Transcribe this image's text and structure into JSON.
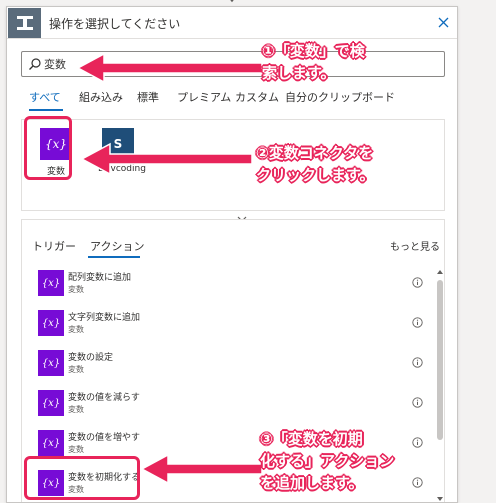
{
  "header": {
    "title": "操作を選択してください",
    "header_icon": "connector-step-icon",
    "close_icon": "close-icon"
  },
  "search": {
    "value": "変数",
    "placeholder": "",
    "icon": "search-icon"
  },
  "tabs": [
    {
      "label": "すべて",
      "active": true
    },
    {
      "label": "組み込み",
      "active": false
    },
    {
      "label": "標準",
      "active": false
    },
    {
      "label": "プレミアム",
      "active": false
    },
    {
      "label": "カスタム",
      "active": false
    },
    {
      "label": "自分のクリップボード",
      "active": false
    }
  ],
  "connectors": [
    {
      "label": "変数",
      "tile_glyph": "{x}",
      "color": "#770bd6"
    },
    {
      "label": "Devcoding",
      "tile_glyph": "S",
      "color": "#1f4e79"
    }
  ],
  "sub_tabs": [
    {
      "label": "トリガー",
      "active": false
    },
    {
      "label": "アクション",
      "active": true
    }
  ],
  "see_more": "もっと見る",
  "actions": [
    {
      "name": "配列変数に追加",
      "connector": "変数",
      "tile_glyph": "{x}"
    },
    {
      "name": "文字列変数に追加",
      "connector": "変数",
      "tile_glyph": "{x}"
    },
    {
      "name": "変数の設定",
      "connector": "変数",
      "tile_glyph": "{x}"
    },
    {
      "name": "変数の値を減らす",
      "connector": "変数",
      "tile_glyph": "{x}"
    },
    {
      "name": "変数の値を増やす",
      "connector": "変数",
      "tile_glyph": "{x}"
    },
    {
      "name": "変数を初期化する",
      "connector": "変数",
      "tile_glyph": "{x}"
    }
  ],
  "annotations": {
    "step1": {
      "line1": "①「変数」で検",
      "line2": "索します。"
    },
    "step2": {
      "line1": "②変数コネクタを",
      "line2": "クリックします。"
    },
    "step3": {
      "line1": "③「変数を初期",
      "line2": "化する」アクション",
      "line3": "を追加します。"
    },
    "accent_color": "#e8245a"
  },
  "colors": {
    "brand_purple": "#770bd6",
    "link_blue": "#0f6cbd",
    "header_gray": "#5a6b7b"
  }
}
